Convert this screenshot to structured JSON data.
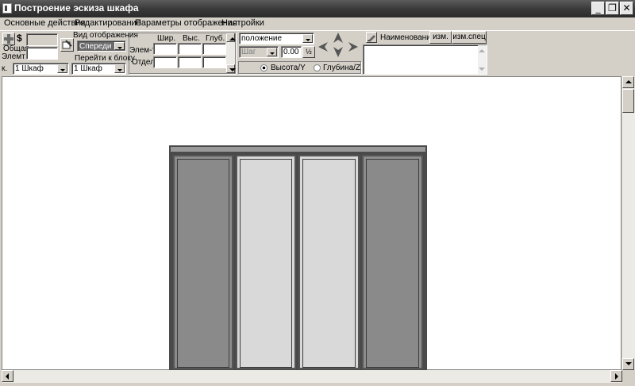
{
  "window": {
    "title": "Построение эскиза шкафа",
    "minimize_glyph": "_",
    "maximize_glyph": "❐",
    "close_glyph": "✕"
  },
  "menu": [
    "Основные действия",
    "Редактирование",
    "Параметры отображения",
    "Настройки"
  ],
  "toolbar": {
    "total_label_line1": "Общая",
    "total_label_line2": "Элемт",
    "currency_symbol": "$",
    "cabinet_prefix": "к.",
    "cabinet_select": "1 Шкаф",
    "view_label": "Вид отображения",
    "view_select": "Спереди",
    "goto_block_label": "Перейти к блоку",
    "goto_block_select": "1 Шкаф",
    "col_width": "Шир.",
    "col_height": "Выс.",
    "col_depth": "Глуб.",
    "row_element": "Элем-т",
    "row_section": "Отдел",
    "position_select": "положение",
    "step_select": "Шаг",
    "step_value": "0.00",
    "radio_height": "Высота/Y",
    "radio_depth": "Глубина/Z",
    "name_label": "Наименование",
    "change_button": "изм.",
    "change_spec_button": "изм.спец"
  },
  "icons": {
    "plus": "plus-icon",
    "tool": "edit-tool-icon",
    "arrows": [
      "arrow-left-icon",
      "arrow-up-icon",
      "arrow-down-icon",
      "arrow-right-icon"
    ],
    "pencil": "pencil-icon"
  },
  "colors": {
    "door_dark": "#8a8a8a",
    "door_light": "#d9d9d9",
    "frame": "#4a4a4a"
  }
}
